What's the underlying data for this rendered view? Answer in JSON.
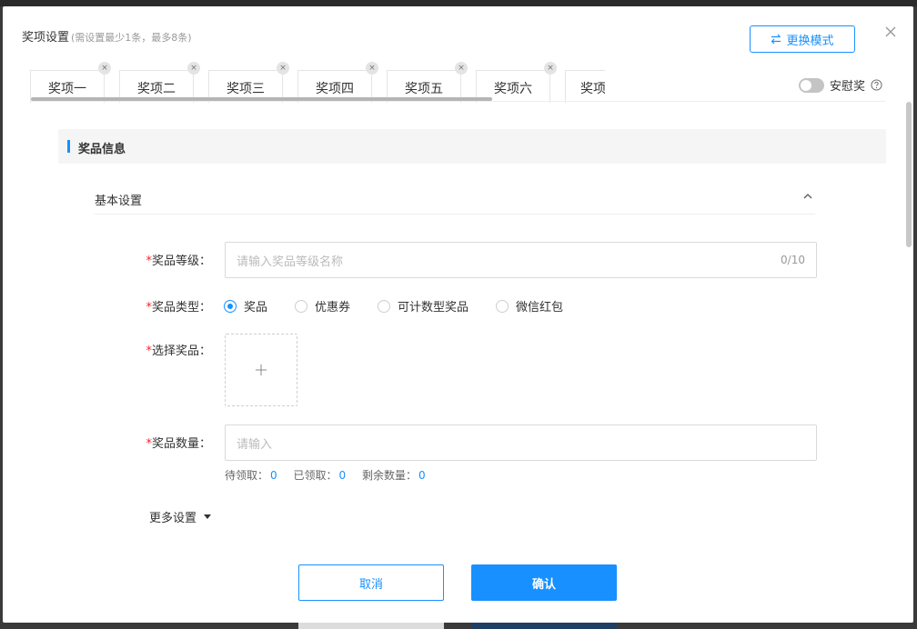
{
  "modal": {
    "title": "奖项设置",
    "title_hint": "(需设置最少1条，最多8条)",
    "switch_mode_label": "更换模式"
  },
  "tabs": [
    {
      "label": "奖项一"
    },
    {
      "label": "奖项二"
    },
    {
      "label": "奖项三"
    },
    {
      "label": "奖项四"
    },
    {
      "label": "奖项五"
    },
    {
      "label": "奖项六"
    },
    {
      "label": "奖项"
    }
  ],
  "tab_close_glyph": "×",
  "consolation": {
    "label": "安慰奖",
    "enabled": false
  },
  "section": {
    "title": "奖品信息"
  },
  "basic": {
    "title": "基本设置"
  },
  "form": {
    "level": {
      "label": "奖品等级：",
      "placeholder": "请输入奖品等级名称",
      "counter": "0/10"
    },
    "type": {
      "label": "奖品类型：",
      "options": [
        {
          "label": "奖品",
          "selected": true
        },
        {
          "label": "优惠券",
          "selected": false
        },
        {
          "label": "可计数型奖品",
          "selected": false
        },
        {
          "label": "微信红包",
          "selected": false
        }
      ]
    },
    "select": {
      "label": "选择奖品："
    },
    "quantity": {
      "label": "奖品数量：",
      "placeholder": "请输入"
    },
    "stats": [
      {
        "label": "待领取：",
        "value": "0"
      },
      {
        "label": "已领取：",
        "value": "0"
      },
      {
        "label": "剩余数量：",
        "value": "0"
      }
    ],
    "more_settings": "更多设置"
  },
  "buttons": {
    "cancel": "取消",
    "confirm": "确认"
  },
  "colors": {
    "accent": "#1890ff",
    "required": "#f5222d",
    "overlay": "#3a3a3a"
  }
}
